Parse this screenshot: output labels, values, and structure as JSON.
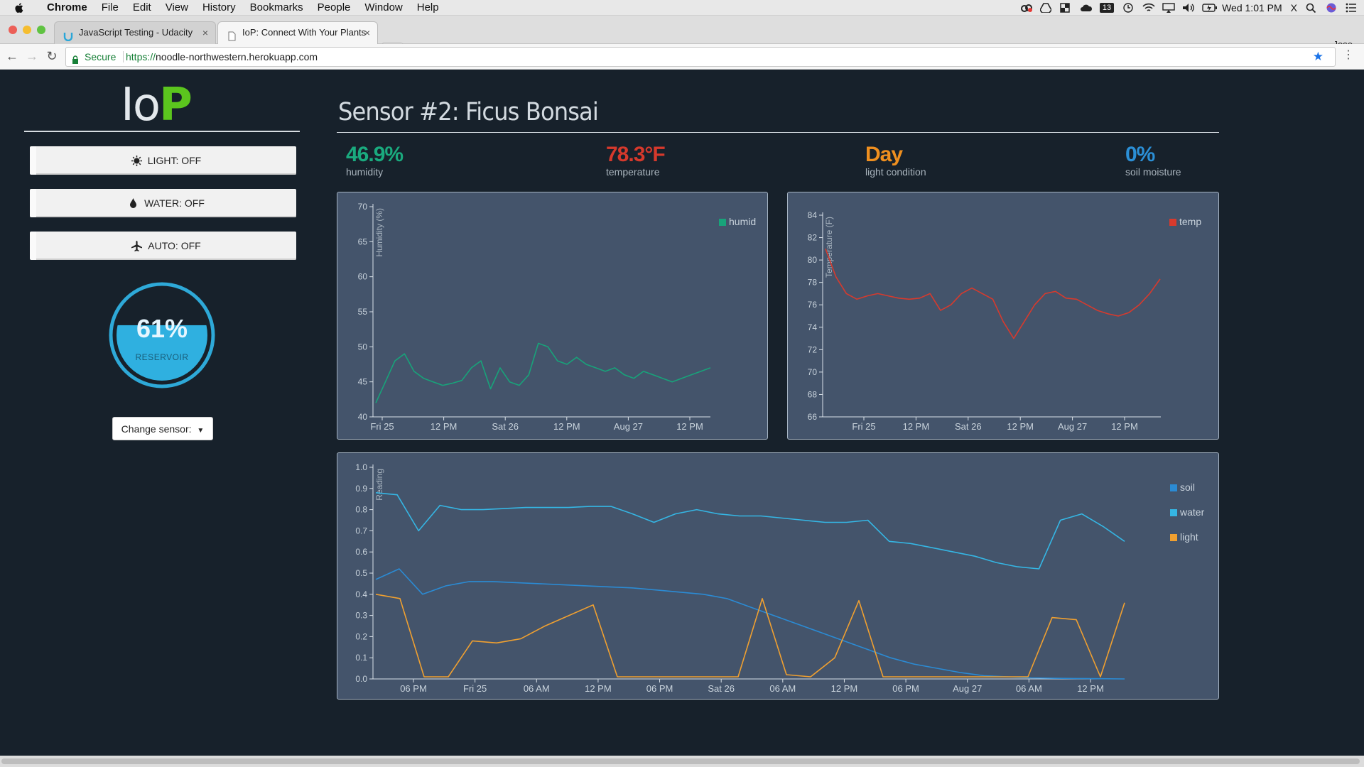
{
  "menubar": {
    "app": "Chrome",
    "items": [
      "File",
      "Edit",
      "View",
      "History",
      "Bookmarks",
      "People",
      "Window",
      "Help"
    ],
    "badge": "13",
    "clock": "Wed 1:01 PM",
    "x": "X"
  },
  "tabs": [
    {
      "title": "JavaScript Testing - Udacity",
      "active": false
    },
    {
      "title": "IoP: Connect With Your Plants",
      "active": true
    }
  ],
  "profile": "Jose",
  "toolbar": {
    "secure_label": "Secure",
    "url_scheme": "https://",
    "url_host": "noodle-northwestern.herokuapp.com"
  },
  "sidebar": {
    "logo_lo": "Io",
    "logo_p": "P",
    "controls": [
      {
        "label": "LIGHT: OFF",
        "icon": "sun-icon"
      },
      {
        "label": "WATER: OFF",
        "icon": "droplet-icon"
      },
      {
        "label": "AUTO: OFF",
        "icon": "plane-icon"
      }
    ],
    "reservoir": {
      "value": "61%",
      "label": "RESERVOIR",
      "fill_fraction": 0.61
    },
    "change_sensor": "Change sensor:"
  },
  "main": {
    "title": "Sensor #2: Ficus Bonsai",
    "stats": [
      {
        "value": "46.9%",
        "label": "humidity",
        "color": "#1aaa7e"
      },
      {
        "value": "78.3°F",
        "label": "temperature",
        "color": "#d6392c"
      },
      {
        "value": "Day",
        "label": "light condition",
        "color": "#ef8f1f"
      },
      {
        "value": "0%",
        "label": "soil moisture",
        "color": "#2b8fd6"
      }
    ]
  },
  "chart_data": [
    {
      "type": "line",
      "ylabel": "Humidity (%)",
      "ylim": [
        40,
        70
      ],
      "yticks": [
        40,
        45,
        50,
        55,
        60,
        65,
        70
      ],
      "xticks": [
        "Fri 25",
        "12 PM",
        "Sat 26",
        "12 PM",
        "Aug 27",
        "12 PM"
      ],
      "series": [
        {
          "name": "humid",
          "color": "#18a37a",
          "values": [
            42,
            45,
            48,
            49,
            46.5,
            45.5,
            45,
            44.5,
            44.8,
            45.2,
            47,
            48,
            44,
            47,
            45,
            44.5,
            46,
            50.5,
            50,
            48,
            47.5,
            48.5,
            47.5,
            47,
            46.5,
            47,
            46,
            45.5,
            46.5,
            46,
            45.5,
            45,
            45.5,
            46,
            46.5,
            47
          ]
        }
      ],
      "legend": "top-right"
    },
    {
      "type": "line",
      "ylabel": "Temperature (F)",
      "ylim": [
        66,
        84
      ],
      "yticks": [
        66,
        68,
        70,
        72,
        74,
        76,
        78,
        80,
        82,
        84
      ],
      "xticks": [
        "Fri 25",
        "12 PM",
        "Sat 26",
        "12 PM",
        "Aug 27",
        "12 PM"
      ],
      "series": [
        {
          "name": "temp",
          "color": "#d73a2d",
          "values": [
            81,
            78.5,
            77,
            76.5,
            76.8,
            77,
            76.8,
            76.6,
            76.5,
            76.6,
            77,
            75.5,
            76,
            77,
            77.5,
            77,
            76.5,
            74.5,
            73,
            74.5,
            76,
            77,
            77.2,
            76.6,
            76.5,
            76,
            75.5,
            75.2,
            75,
            75.3,
            76,
            77,
            78.3
          ]
        }
      ],
      "legend": "top-right"
    },
    {
      "type": "line",
      "ylabel": "Reading",
      "ylim": [
        0,
        1.0
      ],
      "yticks": [
        0.0,
        0.1,
        0.2,
        0.3,
        0.4,
        0.5,
        0.6,
        0.7,
        0.8,
        0.9,
        1.0
      ],
      "xticks": [
        "06 PM",
        "Fri 25",
        "06 AM",
        "12 PM",
        "06 PM",
        "Sat 26",
        "06 AM",
        "12 PM",
        "06 PM",
        "Aug 27",
        "06 AM",
        "12 PM"
      ],
      "series": [
        {
          "name": "soil",
          "color": "#2b8bd4",
          "values": [
            0.47,
            0.52,
            0.4,
            0.44,
            0.46,
            0.46,
            0.455,
            0.45,
            0.445,
            0.44,
            0.435,
            0.43,
            0.42,
            0.41,
            0.4,
            0.38,
            0.34,
            0.3,
            0.26,
            0.22,
            0.18,
            0.14,
            0.1,
            0.07,
            0.05,
            0.03,
            0.015,
            0.01,
            0.005,
            0.003,
            0.002,
            0.001,
            0.0
          ]
        },
        {
          "name": "water",
          "color": "#35b6e4",
          "values": [
            0.88,
            0.87,
            0.7,
            0.82,
            0.8,
            0.8,
            0.805,
            0.81,
            0.81,
            0.81,
            0.815,
            0.815,
            0.78,
            0.74,
            0.78,
            0.8,
            0.78,
            0.77,
            0.77,
            0.76,
            0.75,
            0.74,
            0.74,
            0.75,
            0.65,
            0.64,
            0.62,
            0.6,
            0.58,
            0.55,
            0.53,
            0.52,
            0.75,
            0.78,
            0.72,
            0.65
          ]
        },
        {
          "name": "light",
          "color": "#f0a030",
          "values": [
            0.4,
            0.38,
            0.01,
            0.01,
            0.18,
            0.17,
            0.19,
            0.25,
            0.3,
            0.35,
            0.01,
            0.01,
            0.01,
            0.01,
            0.01,
            0.01,
            0.38,
            0.02,
            0.01,
            0.1,
            0.37,
            0.01,
            0.01,
            0.01,
            0.01,
            0.01,
            0.01,
            0.01,
            0.29,
            0.28,
            0.01,
            0.36
          ]
        }
      ],
      "legend": "top-right"
    }
  ]
}
